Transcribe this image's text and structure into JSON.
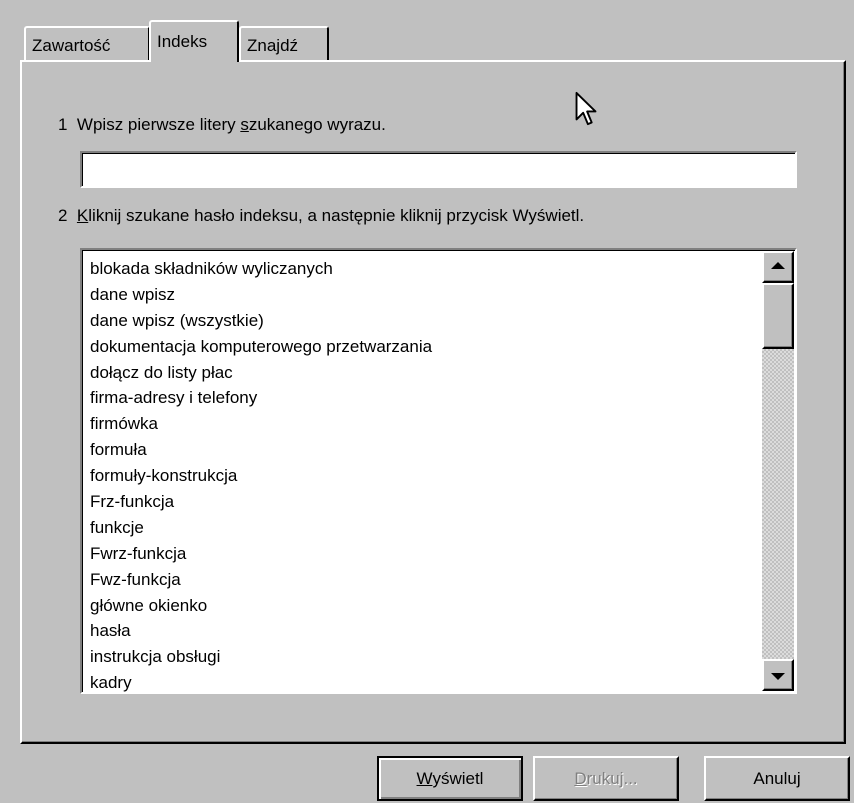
{
  "tabs": [
    {
      "label": "Zawartość",
      "active": false
    },
    {
      "label": "Indeks",
      "active": true
    },
    {
      "label": "Znajdź",
      "active": false
    }
  ],
  "step1": {
    "number": "1",
    "text_prefix": "Wpisz pierwsze litery ",
    "text_underlined": "s",
    "text_suffix": "zukanego wyrazu."
  },
  "search": {
    "value": "",
    "placeholder": ""
  },
  "step2": {
    "number": "2",
    "text_underlined": "K",
    "text_suffix": "liknij szukane hasło indeksu, a następnie kliknij przycisk Wyświetl."
  },
  "index_items": [
    "blokada składników wyliczanych",
    "dane wpisz",
    "dane wpisz (wszystkie)",
    "dokumentacja komputerowego przetwarzania",
    "dołącz do listy płac",
    "firma-adresy i telefony",
    "firmówka",
    "formuła",
    "formuły-konstrukcja",
    "Frz-funkcja",
    "funkcje",
    "Fwrz-funkcja",
    "Fwz-funkcja",
    "główne okienko",
    "hasła",
    "instrukcja obsługi",
    "kadry"
  ],
  "buttons": {
    "display": {
      "underlined": "W",
      "rest": "yświetl"
    },
    "print": {
      "underlined": "D",
      "rest": "rukuj...",
      "enabled": false
    },
    "cancel": {
      "label": "Anuluj"
    }
  },
  "icons": {
    "scroll_up": "scroll-up-arrow-icon",
    "scroll_down": "scroll-down-arrow-icon",
    "cursor": "mouse-pointer-icon"
  }
}
